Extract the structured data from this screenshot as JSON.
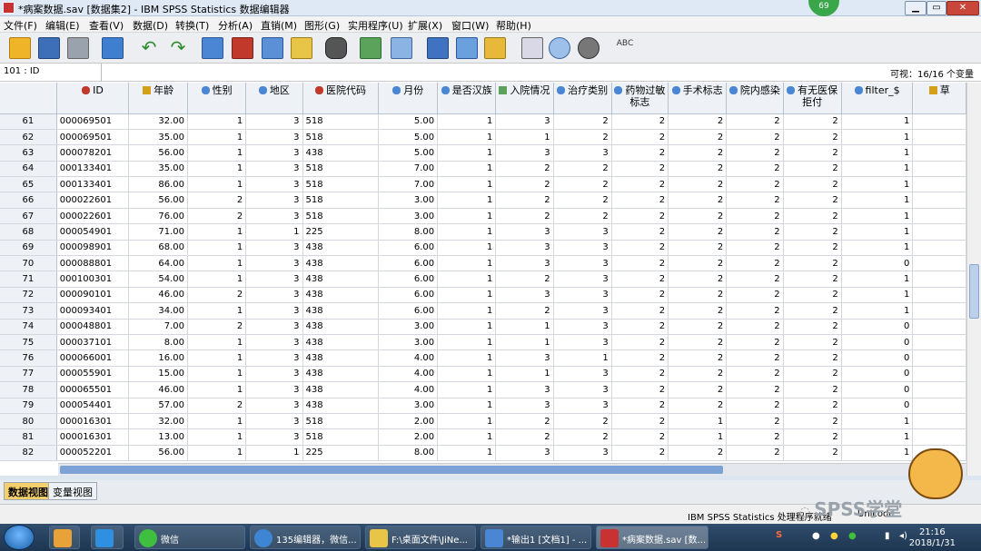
{
  "window": {
    "title": "*病案数据.sav [数据集2] - IBM SPSS Statistics 数据编辑器",
    "badge": "69",
    "min": "▁",
    "max": "▭",
    "close": "✕"
  },
  "menu": [
    "文件(F)",
    "编辑(E)",
    "查看(V)",
    "数据(D)",
    "转换(T)",
    "分析(A)",
    "直销(M)",
    "图形(G)",
    "实用程序(U)",
    "扩展(X)",
    "窗口(W)",
    "帮助(H)"
  ],
  "cellref": "101 : ID",
  "visible": "可视：16/16 个变量",
  "columns": [
    "ID",
    "年龄",
    "性别",
    "地区",
    "医院代码",
    "月份",
    "是否汉族",
    "入院情况",
    "治疗类别",
    "药物过敏标志",
    "手术标志",
    "院内感染",
    "有无医保拒付",
    "filter_$",
    "草"
  ],
  "rows": [
    [
      "61",
      "000069501",
      "32.00",
      "1",
      "3",
      "518",
      "5.00",
      "1",
      "3",
      "2",
      "2",
      "2",
      "2",
      "2",
      "1"
    ],
    [
      "62",
      "000069501",
      "35.00",
      "1",
      "3",
      "518",
      "5.00",
      "1",
      "1",
      "2",
      "2",
      "2",
      "2",
      "2",
      "1"
    ],
    [
      "63",
      "000078201",
      "56.00",
      "1",
      "3",
      "438",
      "5.00",
      "1",
      "3",
      "3",
      "2",
      "2",
      "2",
      "2",
      "1"
    ],
    [
      "64",
      "000133401",
      "35.00",
      "1",
      "3",
      "518",
      "7.00",
      "1",
      "2",
      "2",
      "2",
      "2",
      "2",
      "2",
      "1"
    ],
    [
      "65",
      "000133401",
      "86.00",
      "1",
      "3",
      "518",
      "7.00",
      "1",
      "2",
      "2",
      "2",
      "2",
      "2",
      "2",
      "1"
    ],
    [
      "66",
      "000022601",
      "56.00",
      "2",
      "3",
      "518",
      "3.00",
      "1",
      "2",
      "2",
      "2",
      "2",
      "2",
      "2",
      "1"
    ],
    [
      "67",
      "000022601",
      "76.00",
      "2",
      "3",
      "518",
      "3.00",
      "1",
      "2",
      "2",
      "2",
      "2",
      "2",
      "2",
      "1"
    ],
    [
      "68",
      "000054901",
      "71.00",
      "1",
      "1",
      "225",
      "8.00",
      "1",
      "3",
      "3",
      "2",
      "2",
      "2",
      "2",
      "1"
    ],
    [
      "69",
      "000098901",
      "68.00",
      "1",
      "3",
      "438",
      "6.00",
      "1",
      "3",
      "3",
      "2",
      "2",
      "2",
      "2",
      "1"
    ],
    [
      "70",
      "000088801",
      "64.00",
      "1",
      "3",
      "438",
      "6.00",
      "1",
      "3",
      "3",
      "2",
      "2",
      "2",
      "2",
      "0"
    ],
    [
      "71",
      "000100301",
      "54.00",
      "1",
      "3",
      "438",
      "6.00",
      "1",
      "2",
      "3",
      "2",
      "2",
      "2",
      "2",
      "1"
    ],
    [
      "72",
      "000090101",
      "46.00",
      "2",
      "3",
      "438",
      "6.00",
      "1",
      "3",
      "3",
      "2",
      "2",
      "2",
      "2",
      "1"
    ],
    [
      "73",
      "000093401",
      "34.00",
      "1",
      "3",
      "438",
      "6.00",
      "1",
      "2",
      "3",
      "2",
      "2",
      "2",
      "2",
      "1"
    ],
    [
      "74",
      "000048801",
      "7.00",
      "2",
      "3",
      "438",
      "3.00",
      "1",
      "1",
      "3",
      "2",
      "2",
      "2",
      "2",
      "0"
    ],
    [
      "75",
      "000037101",
      "8.00",
      "1",
      "3",
      "438",
      "3.00",
      "1",
      "1",
      "3",
      "2",
      "2",
      "2",
      "2",
      "0"
    ],
    [
      "76",
      "000066001",
      "16.00",
      "1",
      "3",
      "438",
      "4.00",
      "1",
      "3",
      "1",
      "2",
      "2",
      "2",
      "2",
      "0"
    ],
    [
      "77",
      "000055901",
      "15.00",
      "1",
      "3",
      "438",
      "4.00",
      "1",
      "1",
      "3",
      "2",
      "2",
      "2",
      "2",
      "0"
    ],
    [
      "78",
      "000065501",
      "46.00",
      "1",
      "3",
      "438",
      "4.00",
      "1",
      "3",
      "3",
      "2",
      "2",
      "2",
      "2",
      "0"
    ],
    [
      "79",
      "000054401",
      "57.00",
      "2",
      "3",
      "438",
      "3.00",
      "1",
      "3",
      "3",
      "2",
      "2",
      "2",
      "2",
      "0"
    ],
    [
      "80",
      "000016301",
      "32.00",
      "1",
      "3",
      "518",
      "2.00",
      "1",
      "2",
      "2",
      "2",
      "1",
      "2",
      "2",
      "1"
    ],
    [
      "81",
      "000016301",
      "13.00",
      "1",
      "3",
      "518",
      "2.00",
      "1",
      "2",
      "2",
      "2",
      "1",
      "2",
      "2",
      "1"
    ],
    [
      "82",
      "000052201",
      "56.00",
      "1",
      "1",
      "225",
      "8.00",
      "1",
      "3",
      "3",
      "2",
      "2",
      "2",
      "2",
      "1"
    ]
  ],
  "tabs": {
    "data_view": "数据视图",
    "variable_view": "变量视图"
  },
  "status": "IBM SPSS Statistics 处理程序就绪",
  "status_unicode": "Unicode",
  "watermark": "SPSS学堂",
  "taskbar": {
    "wechat": "微信",
    "editor": "135编辑器，微信...",
    "folder": "F:\\桌面文件\\JiNe...",
    "output": "*输出1 [文档1] - ...",
    "data": "*病案数据.sav [数..."
  },
  "clock": {
    "time": "21:16",
    "date": "2018/1/31"
  },
  "colors": {
    "accent": "#2b6cc4",
    "header": "#eef2f7",
    "title": "#dfe9f5"
  }
}
